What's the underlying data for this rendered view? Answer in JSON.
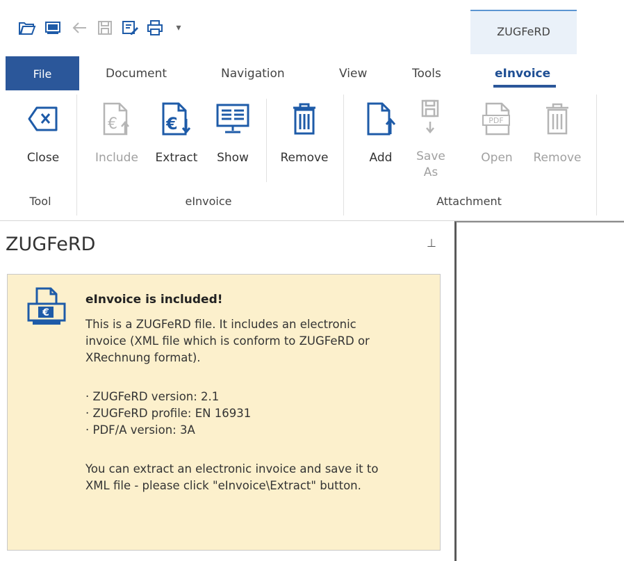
{
  "quick_access": {
    "icons": [
      "open-folder-icon",
      "screen-icon",
      "back-arrow-icon",
      "save-icon",
      "edit-icon",
      "print-icon",
      "customize-dropdown-icon"
    ],
    "customize_glyph": "▾"
  },
  "context_tab": {
    "label": "ZUGFeRD"
  },
  "tabs": {
    "file": "File",
    "document": "Document",
    "navigation": "Navigation",
    "view": "View",
    "tools": "Tools",
    "einvoice": "eInvoice",
    "active": "eInvoice"
  },
  "ribbon": {
    "tool_group": {
      "label": "Tool",
      "close": "Close"
    },
    "einvoice_group": {
      "label": "eInvoice",
      "include": "Include",
      "extract": "Extract",
      "show": "Show",
      "remove": "Remove"
    },
    "attachment_group": {
      "label": "Attachment",
      "add": "Add",
      "save_as_line1": "Save",
      "save_as_line2": "As",
      "open": "Open",
      "remove": "Remove",
      "pdf_badge": "PDF"
    }
  },
  "panel": {
    "title": "ZUGFeRD",
    "pin_glyph": "⊥",
    "heading": "eInvoice is included!",
    "body_lines": [
      "This is a ZUGFeRD file. It includes an electronic",
      "invoice (XML file which is conform to ZUGFeRD or",
      "XRechnung format)."
    ],
    "details": [
      "· ZUGFeRD version: 2.1",
      "· ZUGFeRD profile: EN 16931",
      "· PDF/A version: 3A"
    ],
    "footer_lines": [
      "You can extract an electronic invoice and save it to",
      "XML file - please click \"eInvoice\\Extract\" button."
    ]
  },
  "colors": {
    "accent": "#2b579a",
    "icon_blue": "#1e5ba8",
    "disabled_icon": "#b5b5b5",
    "info_background": "#fcf0cc"
  }
}
